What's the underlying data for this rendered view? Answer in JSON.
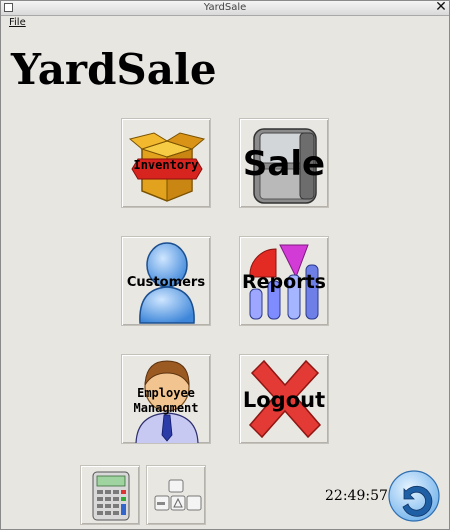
{
  "window": {
    "title": "YardSale"
  },
  "menu": {
    "file": "File"
  },
  "app": {
    "title": "YardSale"
  },
  "tiles": {
    "inventory": "Inventory",
    "sale": "Sale",
    "customers": "Customers",
    "reports": "Reports",
    "employee_line1": "Employee",
    "employee_line2": "Managment",
    "logout": "Logout"
  },
  "status": {
    "clock": "22:49:57"
  },
  "icons": {
    "window_menu": "window-menu-icon",
    "close": "close-icon",
    "calculator": "calculator-icon",
    "keyboard": "keyboard-icon",
    "back": "undo-arrow-icon"
  }
}
